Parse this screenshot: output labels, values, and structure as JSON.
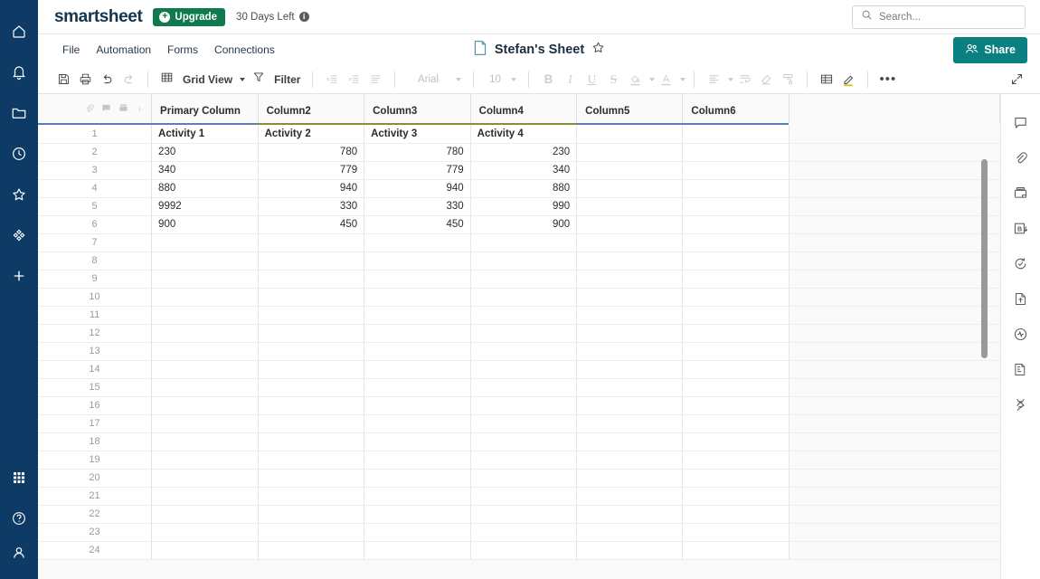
{
  "brand": {
    "name": "smartsheet",
    "upgrade_label": "Upgrade",
    "trial_text": "30 Days Left",
    "info_glyph": "i"
  },
  "search": {
    "placeholder": "Search...",
    "value": "Search..."
  },
  "menubar": {
    "items": [
      {
        "label": "File"
      },
      {
        "label": "Automation"
      },
      {
        "label": "Forms"
      },
      {
        "label": "Connections"
      }
    ],
    "sheet_title": "Stefan's Sheet",
    "share_label": "Share"
  },
  "toolbar": {
    "view_label": "Grid View",
    "filter_label": "Filter",
    "font_name": "Arial",
    "font_size": "10",
    "bold": "B",
    "italic": "I",
    "underline": "U",
    "strikethrough": "S",
    "text_color": "A",
    "more": "•••"
  },
  "grid": {
    "columns": [
      {
        "label": "Primary Column",
        "underline": "blue"
      },
      {
        "label": "Column2",
        "underline": "olive"
      },
      {
        "label": "Column3",
        "underline": "olive"
      },
      {
        "label": "Column4",
        "underline": "olive"
      },
      {
        "label": "Column5",
        "underline": "blue"
      },
      {
        "label": "Column6",
        "underline": "blue"
      }
    ],
    "rows": [
      {
        "num": "1",
        "cells": [
          "Activity 1",
          "Activity 2",
          "Activity 3",
          "Activity 4",
          "",
          ""
        ],
        "style": "highlight",
        "align": "left"
      },
      {
        "num": "2",
        "cells": [
          "230",
          "780",
          "780",
          "230",
          "",
          ""
        ],
        "style": "normal",
        "align": "mixed"
      },
      {
        "num": "3",
        "cells": [
          "340",
          "779",
          "779",
          "340",
          "",
          ""
        ],
        "style": "normal",
        "align": "mixed"
      },
      {
        "num": "4",
        "cells": [
          "880",
          "940",
          "940",
          "880",
          "",
          ""
        ],
        "style": "normal",
        "align": "mixed"
      },
      {
        "num": "5",
        "cells": [
          "9992",
          "330",
          "330",
          "990",
          "",
          ""
        ],
        "style": "normal",
        "align": "mixed"
      },
      {
        "num": "6",
        "cells": [
          "900",
          "450",
          "450",
          "900",
          "",
          ""
        ],
        "style": "normal",
        "align": "mixed"
      },
      {
        "num": "7",
        "cells": [
          "",
          "",
          "",
          "",
          "",
          ""
        ],
        "style": "selected",
        "align": "left"
      },
      {
        "num": "8",
        "cells": [
          "",
          "",
          "",
          "",
          "",
          ""
        ],
        "style": "normal",
        "align": "left"
      },
      {
        "num": "9",
        "cells": [
          "",
          "",
          "",
          "",
          "",
          ""
        ],
        "style": "normal",
        "align": "left"
      },
      {
        "num": "10",
        "cells": [
          "",
          "",
          "",
          "",
          "",
          ""
        ],
        "style": "normal",
        "align": "left"
      },
      {
        "num": "11",
        "cells": [
          "",
          "",
          "",
          "",
          "",
          ""
        ],
        "style": "normal",
        "align": "left"
      },
      {
        "num": "12",
        "cells": [
          "",
          "",
          "",
          "",
          "",
          ""
        ],
        "style": "normal",
        "align": "left"
      },
      {
        "num": "13",
        "cells": [
          "",
          "",
          "",
          "",
          "",
          ""
        ],
        "style": "normal",
        "align": "left"
      },
      {
        "num": "14",
        "cells": [
          "",
          "",
          "",
          "",
          "",
          ""
        ],
        "style": "normal",
        "align": "left"
      },
      {
        "num": "15",
        "cells": [
          "",
          "",
          "",
          "",
          "",
          ""
        ],
        "style": "normal",
        "align": "left"
      },
      {
        "num": "16",
        "cells": [
          "",
          "",
          "",
          "",
          "",
          ""
        ],
        "style": "normal",
        "align": "left"
      },
      {
        "num": "17",
        "cells": [
          "",
          "",
          "",
          "",
          "",
          ""
        ],
        "style": "normal",
        "align": "left"
      },
      {
        "num": "18",
        "cells": [
          "",
          "",
          "",
          "",
          "",
          ""
        ],
        "style": "normal",
        "align": "left"
      },
      {
        "num": "19",
        "cells": [
          "",
          "",
          "",
          "",
          "",
          ""
        ],
        "style": "normal",
        "align": "left"
      },
      {
        "num": "20",
        "cells": [
          "",
          "",
          "",
          "",
          "",
          ""
        ],
        "style": "normal",
        "align": "left"
      },
      {
        "num": "21",
        "cells": [
          "",
          "",
          "",
          "",
          "",
          ""
        ],
        "style": "normal",
        "align": "left"
      },
      {
        "num": "22",
        "cells": [
          "",
          "",
          "",
          "",
          "",
          ""
        ],
        "style": "normal",
        "align": "left"
      },
      {
        "num": "23",
        "cells": [
          "",
          "",
          "",
          "",
          "",
          ""
        ],
        "style": "normal",
        "align": "left"
      },
      {
        "num": "24",
        "cells": [
          "",
          "",
          "",
          "",
          "",
          ""
        ],
        "style": "normal",
        "align": "left"
      }
    ]
  },
  "left_nav": {
    "items": [
      {
        "icon": "home-icon"
      },
      {
        "icon": "notifications-bell-icon"
      },
      {
        "icon": "browse-folder-icon"
      },
      {
        "icon": "recents-clock-icon"
      },
      {
        "icon": "favorites-star-icon"
      },
      {
        "icon": "solutions-icon"
      },
      {
        "icon": "create-plus-icon"
      }
    ],
    "bottom_items": [
      {
        "icon": "apps-grid-icon"
      },
      {
        "icon": "help-question-icon"
      },
      {
        "icon": "account-user-icon"
      }
    ]
  },
  "right_rail": {
    "items": [
      {
        "icon": "conversations-icon"
      },
      {
        "icon": "attachments-paperclip-icon"
      },
      {
        "icon": "proofs-icon"
      },
      {
        "icon": "baseline-b-icon"
      },
      {
        "icon": "update-requests-icon"
      },
      {
        "icon": "publish-icon"
      },
      {
        "icon": "activity-log-icon"
      },
      {
        "icon": "summary-icon"
      },
      {
        "icon": "dna-helix-icon"
      }
    ]
  },
  "colors": {
    "nav_background": "#0d3b66",
    "upgrade_green": "#0f7a4d",
    "share_teal": "#0a8080",
    "highlight_yellow": "#ffe800",
    "selection_navy": "#133f80"
  }
}
